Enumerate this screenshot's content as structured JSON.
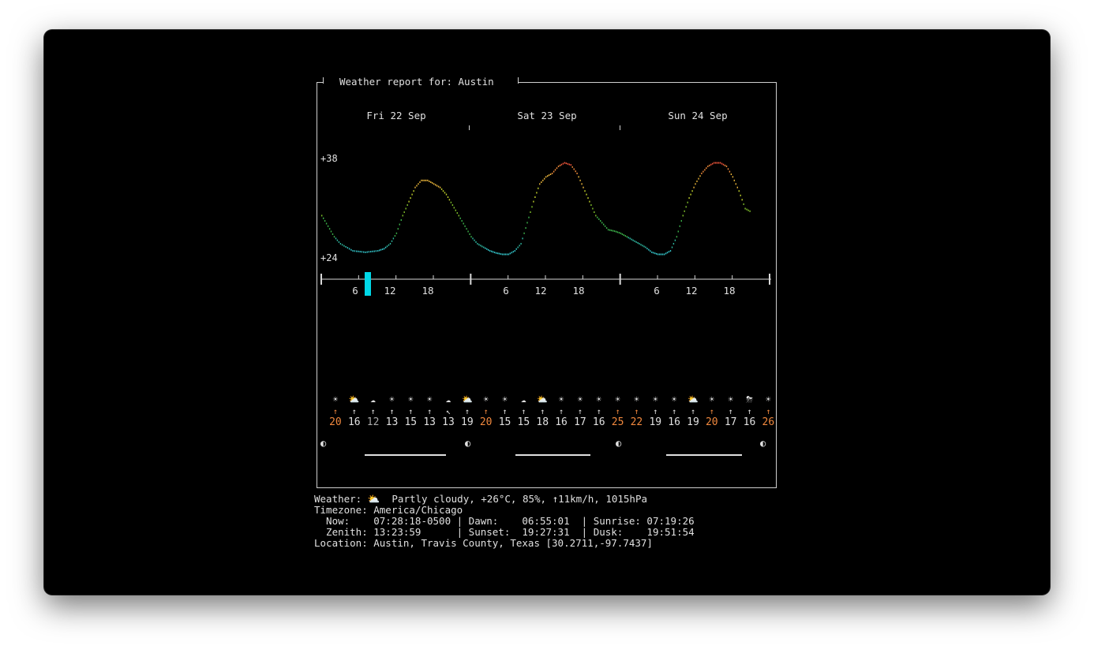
{
  "title": "Weather report for: Austin",
  "days": [
    "Fri 22 Sep",
    "Sat 23 Sep",
    "Sun 24 Sep"
  ],
  "y_labels": {
    "max": "+38",
    "min": "+24"
  },
  "hour_labels": [
    "6",
    "12",
    "18"
  ],
  "current_hour_marker_color": "#00d8e8",
  "chart_data": {
    "type": "line",
    "title": "",
    "xlabel": "",
    "ylabel": "",
    "x_unit": "hour (0-72 across three days)",
    "ylim": [
      24,
      38
    ],
    "temperature_points": [
      [
        0,
        30.0
      ],
      [
        1,
        28.5
      ],
      [
        2,
        27.0
      ],
      [
        3,
        26.0
      ],
      [
        5,
        25.0
      ],
      [
        7,
        24.8
      ],
      [
        9,
        25.0
      ],
      [
        10,
        25.3
      ],
      [
        11,
        26.0
      ],
      [
        12,
        27.5
      ],
      [
        13,
        30.0
      ],
      [
        14,
        32.0
      ],
      [
        15,
        34.0
      ],
      [
        16,
        35.0
      ],
      [
        17,
        35.0
      ],
      [
        18,
        34.5
      ],
      [
        19,
        34.0
      ],
      [
        20,
        33.0
      ],
      [
        21,
        31.5
      ],
      [
        22,
        30.0
      ],
      [
        23,
        28.5
      ],
      [
        24,
        27.0
      ],
      [
        25,
        26.0
      ],
      [
        26,
        25.5
      ],
      [
        27,
        25.0
      ],
      [
        28,
        24.7
      ],
      [
        29,
        24.5
      ],
      [
        30,
        24.5
      ],
      [
        31,
        25.0
      ],
      [
        32,
        26.0
      ],
      [
        33,
        29.0
      ],
      [
        34,
        32.0
      ],
      [
        35,
        34.5
      ],
      [
        36,
        35.5
      ],
      [
        37,
        36.0
      ],
      [
        38,
        37.0
      ],
      [
        39,
        37.5
      ],
      [
        40,
        37.2
      ],
      [
        41,
        36.0
      ],
      [
        42,
        34.0
      ],
      [
        43,
        32.0
      ],
      [
        44,
        30.0
      ],
      [
        45,
        29.0
      ],
      [
        46,
        28.0
      ],
      [
        47,
        27.8
      ],
      [
        48,
        27.5
      ],
      [
        49,
        27.0
      ],
      [
        50,
        26.5
      ],
      [
        51,
        26.0
      ],
      [
        52,
        25.5
      ],
      [
        53,
        24.8
      ],
      [
        54,
        24.5
      ],
      [
        55,
        24.5
      ],
      [
        56,
        25.0
      ],
      [
        57,
        27.0
      ],
      [
        58,
        30.0
      ],
      [
        59,
        32.5
      ],
      [
        60,
        34.5
      ],
      [
        61,
        36.0
      ],
      [
        62,
        37.0
      ],
      [
        63,
        37.5
      ],
      [
        64,
        37.5
      ],
      [
        65,
        37.0
      ],
      [
        66,
        35.5
      ],
      [
        67,
        33.5
      ],
      [
        68,
        31.0
      ],
      [
        69,
        30.5
      ]
    ]
  },
  "weather_icons": [
    "☀",
    "⛅",
    "☁",
    "☀",
    "☀",
    "☀",
    "☁",
    "⛅",
    "☀",
    "☀",
    "☁",
    "⛅",
    "☀",
    "☀",
    "☀",
    "☀",
    "☀",
    "☀",
    "☀",
    "⛅",
    "☀",
    "☀",
    "⛈",
    "☀"
  ],
  "wind_arrows": [
    "↑",
    "↑",
    "↑",
    "↑",
    "↑",
    "↑",
    "↖",
    "↑",
    "↑",
    "↑",
    "↑",
    "↑",
    "↑",
    "↑",
    "↑",
    "↑",
    "↑",
    "↑",
    "↑",
    "↑",
    "↑",
    "↑",
    "↑",
    "↑"
  ],
  "wind_speeds": [
    "20",
    "16",
    "12",
    "13",
    "15",
    "13",
    "13",
    "19",
    "20",
    "15",
    "15",
    "18",
    "16",
    "17",
    "16",
    "25",
    "22",
    "19",
    "16",
    "19",
    "20",
    "17",
    "16",
    "26"
  ],
  "wind_high_flags": [
    true,
    false,
    false,
    false,
    false,
    false,
    false,
    false,
    true,
    false,
    false,
    false,
    false,
    false,
    false,
    true,
    true,
    false,
    false,
    false,
    true,
    false,
    false,
    true
  ],
  "moon_glyph": "◐",
  "info": {
    "weather_label": "Weather:",
    "weather_icon": "⛅",
    "weather_text": "Partly cloudy, +26°C, 85%, ↑11km/h, 1015hPa",
    "timezone": "Timezone: America/Chicago",
    "row_now": "  Now:    07:28:18-0500 | Dawn:    06:55:01  | Sunrise: 07:19:26",
    "row_zenith": "  Zenith: 13:23:59      | Sunset:  19:27:31  | Dusk:    19:51:54",
    "location": "Location: Austin, Travis County, Texas [30.2711,-97.7437]"
  }
}
